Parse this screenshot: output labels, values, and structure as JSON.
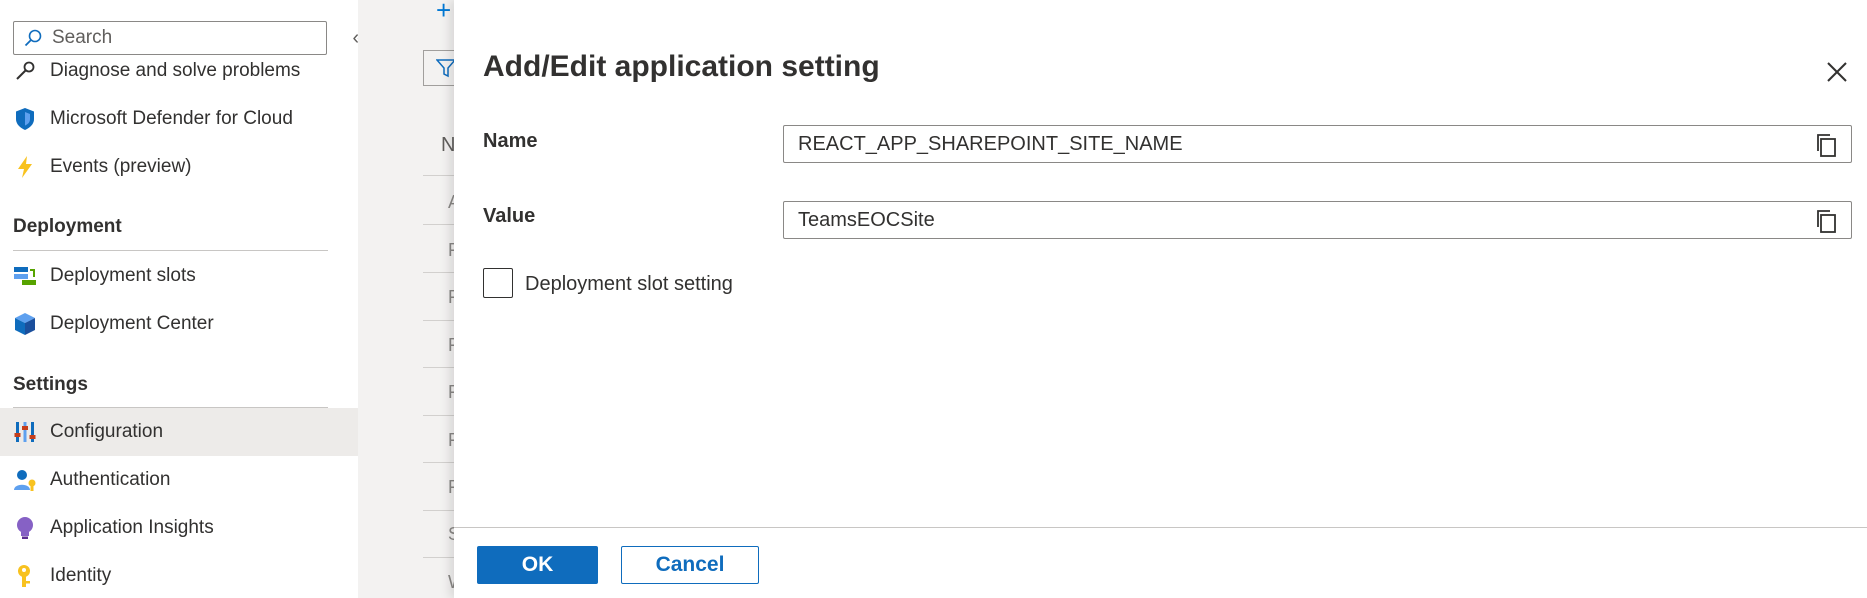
{
  "sidebar": {
    "search_placeholder": "Search",
    "items": [
      {
        "label": "Diagnose and solve problems",
        "icon": "wrench-icon"
      },
      {
        "label": "Microsoft Defender for Cloud",
        "icon": "shield-icon"
      },
      {
        "label": "Events (preview)",
        "icon": "lightning-icon"
      }
    ],
    "sections": [
      {
        "title": "Deployment",
        "items": [
          {
            "label": "Deployment slots",
            "icon": "deployment-slots-icon"
          },
          {
            "label": "Deployment Center",
            "icon": "cube-icon"
          }
        ]
      },
      {
        "title": "Settings",
        "items": [
          {
            "label": "Configuration",
            "icon": "sliders-icon",
            "selected": true
          },
          {
            "label": "Authentication",
            "icon": "user-key-icon"
          },
          {
            "label": "Application Insights",
            "icon": "lightbulb-icon"
          },
          {
            "label": "Identity",
            "icon": "key-icon"
          }
        ]
      }
    ]
  },
  "background_page": {
    "row_letters": [
      "N",
      "A",
      "F",
      "F",
      "F",
      "F",
      "F",
      "F",
      "S",
      "W"
    ]
  },
  "panel": {
    "title": "Add/Edit application setting",
    "name_label": "Name",
    "name_value": "REACT_APP_SHAREPOINT_SITE_NAME",
    "value_label": "Value",
    "value_value": "TeamsEOCSite",
    "checkbox_label": "Deployment slot setting",
    "checkbox_checked": false,
    "ok_label": "OK",
    "cancel_label": "Cancel"
  },
  "colors": {
    "accent": "#0f6cbd",
    "selected_bg": "#edebe9",
    "border": "#8a8886"
  }
}
